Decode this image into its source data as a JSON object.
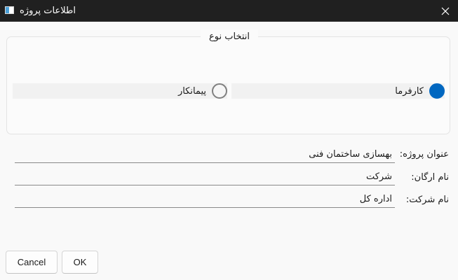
{
  "window": {
    "title": "اطلاعات پروژه"
  },
  "type_group": {
    "title": "انتخاب نوع",
    "options": [
      {
        "label": "کارفرما",
        "checked": true
      },
      {
        "label": "پیمانکار",
        "checked": false
      }
    ]
  },
  "fields": [
    {
      "label": "عنوان پروژه:",
      "value": "بهسازی ساختمان فنی"
    },
    {
      "label": "نام ارگان:",
      "value": "شرکت"
    },
    {
      "label": "نام شرکت:",
      "value": "اداره کل"
    }
  ],
  "buttons": {
    "cancel": "Cancel",
    "ok": "OK"
  },
  "colors": {
    "titlebar": "#202020",
    "accent": "#0067c0"
  }
}
